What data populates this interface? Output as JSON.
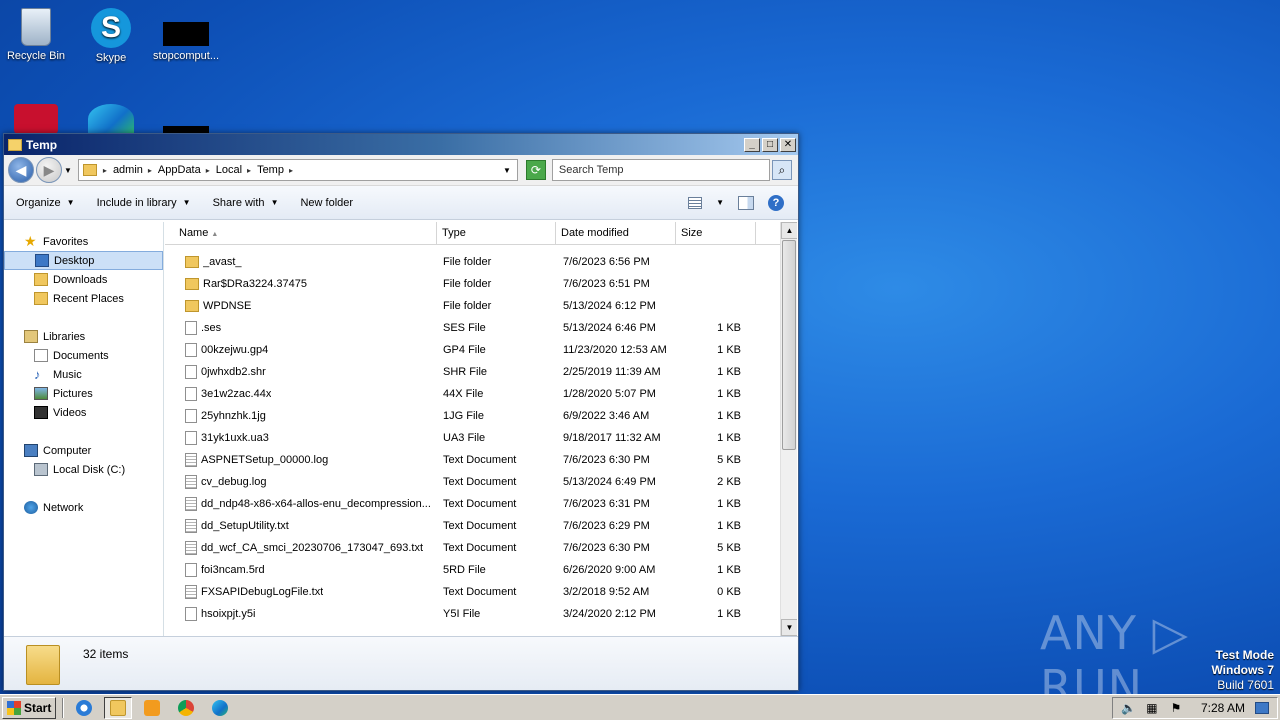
{
  "desktop": {
    "icons": [
      {
        "label": "Recycle Bin",
        "icon": "recycle-bin-icon"
      },
      {
        "label": "Skype",
        "icon": "skype-icon"
      },
      {
        "label": "stopcomput...",
        "icon": "application-icon"
      },
      {
        "label": "",
        "icon": "acrobat-icon"
      },
      {
        "label": "",
        "icon": "edge-icon"
      },
      {
        "label": "",
        "icon": "application-icon"
      }
    ],
    "skype_letter": "S",
    "watermark": "ANY ▷ RUN",
    "test_mode": {
      "line1": "Test Mode",
      "line2": "Windows 7",
      "line3": "Build 7601"
    }
  },
  "window": {
    "title": "Temp",
    "controls": {
      "minimize": "_",
      "maximize": "□",
      "close": "✕"
    },
    "address": {
      "crumbs": [
        "admin",
        "AppData",
        "Local",
        "Temp"
      ],
      "search_placeholder": "Search Temp"
    },
    "toolbar": {
      "organize": "Organize",
      "include": "Include in library",
      "share": "Share with",
      "new_folder": "New folder",
      "help": "?"
    },
    "nav": {
      "favorites": "Favorites",
      "desktop": "Desktop",
      "downloads": "Downloads",
      "recent": "Recent Places",
      "libraries": "Libraries",
      "documents": "Documents",
      "music": "Music",
      "pictures": "Pictures",
      "videos": "Videos",
      "computer": "Computer",
      "local_disk": "Local Disk (C:)",
      "network": "Network"
    },
    "columns": {
      "name": "Name",
      "type": "Type",
      "date": "Date modified",
      "size": "Size"
    },
    "files": [
      {
        "name": "_avast_",
        "type": "File folder",
        "date": "7/6/2023 6:56 PM",
        "size": "",
        "kind": "folder"
      },
      {
        "name": "Rar$DRa3224.37475",
        "type": "File folder",
        "date": "7/6/2023 6:51 PM",
        "size": "",
        "kind": "folder"
      },
      {
        "name": "WPDNSE",
        "type": "File folder",
        "date": "5/13/2024 6:12 PM",
        "size": "",
        "kind": "folder"
      },
      {
        "name": ".ses",
        "type": "SES File",
        "date": "5/13/2024 6:46 PM",
        "size": "1 KB",
        "kind": "file"
      },
      {
        "name": "00kzejwu.gp4",
        "type": "GP4 File",
        "date": "11/23/2020 12:53 AM",
        "size": "1 KB",
        "kind": "file"
      },
      {
        "name": "0jwhxdb2.shr",
        "type": "SHR File",
        "date": "2/25/2019 11:39 AM",
        "size": "1 KB",
        "kind": "file"
      },
      {
        "name": "3e1w2zac.44x",
        "type": "44X File",
        "date": "1/28/2020 5:07 PM",
        "size": "1 KB",
        "kind": "file"
      },
      {
        "name": "25yhnzhk.1jg",
        "type": "1JG File",
        "date": "6/9/2022 3:46 AM",
        "size": "1 KB",
        "kind": "file"
      },
      {
        "name": "31yk1uxk.ua3",
        "type": "UA3 File",
        "date": "9/18/2017 11:32 AM",
        "size": "1 KB",
        "kind": "file"
      },
      {
        "name": "ASPNETSetup_00000.log",
        "type": "Text Document",
        "date": "7/6/2023 6:30 PM",
        "size": "5 KB",
        "kind": "text"
      },
      {
        "name": "cv_debug.log",
        "type": "Text Document",
        "date": "5/13/2024 6:49 PM",
        "size": "2 KB",
        "kind": "text"
      },
      {
        "name": "dd_ndp48-x86-x64-allos-enu_decompression...",
        "type": "Text Document",
        "date": "7/6/2023 6:31 PM",
        "size": "1 KB",
        "kind": "text"
      },
      {
        "name": "dd_SetupUtility.txt",
        "type": "Text Document",
        "date": "7/6/2023 6:29 PM",
        "size": "1 KB",
        "kind": "text"
      },
      {
        "name": "dd_wcf_CA_smci_20230706_173047_693.txt",
        "type": "Text Document",
        "date": "7/6/2023 6:30 PM",
        "size": "5 KB",
        "kind": "text"
      },
      {
        "name": "foi3ncam.5rd",
        "type": "5RD File",
        "date": "6/26/2020 9:00 AM",
        "size": "1 KB",
        "kind": "file"
      },
      {
        "name": "FXSAPIDebugLogFile.txt",
        "type": "Text Document",
        "date": "3/2/2018 9:52 AM",
        "size": "0 KB",
        "kind": "text"
      },
      {
        "name": "hsoixpjt.y5i",
        "type": "Y5I File",
        "date": "3/24/2020 2:12 PM",
        "size": "1 KB",
        "kind": "file"
      }
    ],
    "status": {
      "count": "32 items"
    }
  },
  "taskbar": {
    "start": "Start",
    "apps": [
      "internet-explorer-icon",
      "explorer-icon",
      "media-player-icon",
      "chrome-icon",
      "edge-icon"
    ],
    "clock": "7:28 AM"
  }
}
